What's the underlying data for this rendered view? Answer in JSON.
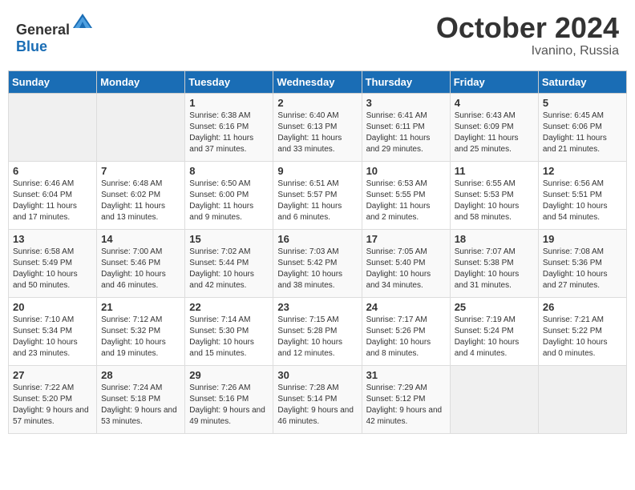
{
  "header": {
    "logo_general": "General",
    "logo_blue": "Blue",
    "month_year": "October 2024",
    "location": "Ivanino, Russia"
  },
  "days_of_week": [
    "Sunday",
    "Monday",
    "Tuesday",
    "Wednesday",
    "Thursday",
    "Friday",
    "Saturday"
  ],
  "weeks": [
    [
      {
        "day": "",
        "sunrise": "",
        "sunset": "",
        "daylight": "",
        "empty": true
      },
      {
        "day": "",
        "sunrise": "",
        "sunset": "",
        "daylight": "",
        "empty": true
      },
      {
        "day": "1",
        "sunrise": "Sunrise: 6:38 AM",
        "sunset": "Sunset: 6:16 PM",
        "daylight": "Daylight: 11 hours and 37 minutes."
      },
      {
        "day": "2",
        "sunrise": "Sunrise: 6:40 AM",
        "sunset": "Sunset: 6:13 PM",
        "daylight": "Daylight: 11 hours and 33 minutes."
      },
      {
        "day": "3",
        "sunrise": "Sunrise: 6:41 AM",
        "sunset": "Sunset: 6:11 PM",
        "daylight": "Daylight: 11 hours and 29 minutes."
      },
      {
        "day": "4",
        "sunrise": "Sunrise: 6:43 AM",
        "sunset": "Sunset: 6:09 PM",
        "daylight": "Daylight: 11 hours and 25 minutes."
      },
      {
        "day": "5",
        "sunrise": "Sunrise: 6:45 AM",
        "sunset": "Sunset: 6:06 PM",
        "daylight": "Daylight: 11 hours and 21 minutes."
      }
    ],
    [
      {
        "day": "6",
        "sunrise": "Sunrise: 6:46 AM",
        "sunset": "Sunset: 6:04 PM",
        "daylight": "Daylight: 11 hours and 17 minutes."
      },
      {
        "day": "7",
        "sunrise": "Sunrise: 6:48 AM",
        "sunset": "Sunset: 6:02 PM",
        "daylight": "Daylight: 11 hours and 13 minutes."
      },
      {
        "day": "8",
        "sunrise": "Sunrise: 6:50 AM",
        "sunset": "Sunset: 6:00 PM",
        "daylight": "Daylight: 11 hours and 9 minutes."
      },
      {
        "day": "9",
        "sunrise": "Sunrise: 6:51 AM",
        "sunset": "Sunset: 5:57 PM",
        "daylight": "Daylight: 11 hours and 6 minutes."
      },
      {
        "day": "10",
        "sunrise": "Sunrise: 6:53 AM",
        "sunset": "Sunset: 5:55 PM",
        "daylight": "Daylight: 11 hours and 2 minutes."
      },
      {
        "day": "11",
        "sunrise": "Sunrise: 6:55 AM",
        "sunset": "Sunset: 5:53 PM",
        "daylight": "Daylight: 10 hours and 58 minutes."
      },
      {
        "day": "12",
        "sunrise": "Sunrise: 6:56 AM",
        "sunset": "Sunset: 5:51 PM",
        "daylight": "Daylight: 10 hours and 54 minutes."
      }
    ],
    [
      {
        "day": "13",
        "sunrise": "Sunrise: 6:58 AM",
        "sunset": "Sunset: 5:49 PM",
        "daylight": "Daylight: 10 hours and 50 minutes."
      },
      {
        "day": "14",
        "sunrise": "Sunrise: 7:00 AM",
        "sunset": "Sunset: 5:46 PM",
        "daylight": "Daylight: 10 hours and 46 minutes."
      },
      {
        "day": "15",
        "sunrise": "Sunrise: 7:02 AM",
        "sunset": "Sunset: 5:44 PM",
        "daylight": "Daylight: 10 hours and 42 minutes."
      },
      {
        "day": "16",
        "sunrise": "Sunrise: 7:03 AM",
        "sunset": "Sunset: 5:42 PM",
        "daylight": "Daylight: 10 hours and 38 minutes."
      },
      {
        "day": "17",
        "sunrise": "Sunrise: 7:05 AM",
        "sunset": "Sunset: 5:40 PM",
        "daylight": "Daylight: 10 hours and 34 minutes."
      },
      {
        "day": "18",
        "sunrise": "Sunrise: 7:07 AM",
        "sunset": "Sunset: 5:38 PM",
        "daylight": "Daylight: 10 hours and 31 minutes."
      },
      {
        "day": "19",
        "sunrise": "Sunrise: 7:08 AM",
        "sunset": "Sunset: 5:36 PM",
        "daylight": "Daylight: 10 hours and 27 minutes."
      }
    ],
    [
      {
        "day": "20",
        "sunrise": "Sunrise: 7:10 AM",
        "sunset": "Sunset: 5:34 PM",
        "daylight": "Daylight: 10 hours and 23 minutes."
      },
      {
        "day": "21",
        "sunrise": "Sunrise: 7:12 AM",
        "sunset": "Sunset: 5:32 PM",
        "daylight": "Daylight: 10 hours and 19 minutes."
      },
      {
        "day": "22",
        "sunrise": "Sunrise: 7:14 AM",
        "sunset": "Sunset: 5:30 PM",
        "daylight": "Daylight: 10 hours and 15 minutes."
      },
      {
        "day": "23",
        "sunrise": "Sunrise: 7:15 AM",
        "sunset": "Sunset: 5:28 PM",
        "daylight": "Daylight: 10 hours and 12 minutes."
      },
      {
        "day": "24",
        "sunrise": "Sunrise: 7:17 AM",
        "sunset": "Sunset: 5:26 PM",
        "daylight": "Daylight: 10 hours and 8 minutes."
      },
      {
        "day": "25",
        "sunrise": "Sunrise: 7:19 AM",
        "sunset": "Sunset: 5:24 PM",
        "daylight": "Daylight: 10 hours and 4 minutes."
      },
      {
        "day": "26",
        "sunrise": "Sunrise: 7:21 AM",
        "sunset": "Sunset: 5:22 PM",
        "daylight": "Daylight: 10 hours and 0 minutes."
      }
    ],
    [
      {
        "day": "27",
        "sunrise": "Sunrise: 7:22 AM",
        "sunset": "Sunset: 5:20 PM",
        "daylight": "Daylight: 9 hours and 57 minutes."
      },
      {
        "day": "28",
        "sunrise": "Sunrise: 7:24 AM",
        "sunset": "Sunset: 5:18 PM",
        "daylight": "Daylight: 9 hours and 53 minutes."
      },
      {
        "day": "29",
        "sunrise": "Sunrise: 7:26 AM",
        "sunset": "Sunset: 5:16 PM",
        "daylight": "Daylight: 9 hours and 49 minutes."
      },
      {
        "day": "30",
        "sunrise": "Sunrise: 7:28 AM",
        "sunset": "Sunset: 5:14 PM",
        "daylight": "Daylight: 9 hours and 46 minutes."
      },
      {
        "day": "31",
        "sunrise": "Sunrise: 7:29 AM",
        "sunset": "Sunset: 5:12 PM",
        "daylight": "Daylight: 9 hours and 42 minutes."
      },
      {
        "day": "",
        "sunrise": "",
        "sunset": "",
        "daylight": "",
        "empty": true
      },
      {
        "day": "",
        "sunrise": "",
        "sunset": "",
        "daylight": "",
        "empty": true
      }
    ]
  ]
}
